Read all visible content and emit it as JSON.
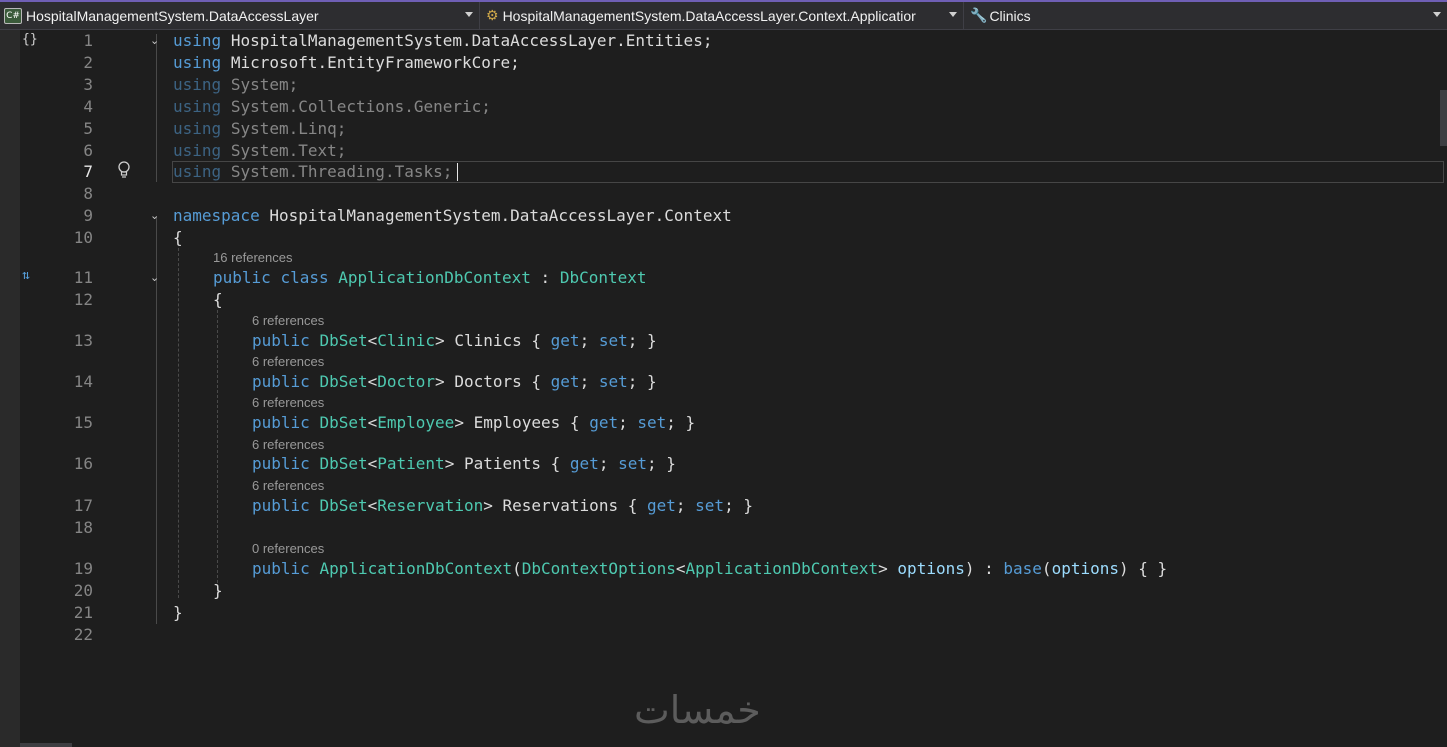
{
  "navbar": {
    "project": "HospitalManagementSystem.DataAccessLayer",
    "type_scope": "HospitalManagementSystem.DataAccessLayer.Context.Applicatior",
    "member": "Clinics"
  },
  "refs": {
    "class": "16 references",
    "clinics": "6 references",
    "doctors": "6 references",
    "employees": "6 references",
    "patients": "6 references",
    "reservations": "6 references",
    "ctor": "0 references"
  },
  "code": {
    "kw_using": "using",
    "kw_namespace": "namespace",
    "kw_public": "public",
    "kw_class": "class",
    "kw_get": "get",
    "kw_set": "set",
    "kw_base": "base",
    "ns_entities": "HospitalManagementSystem.DataAccessLayer.Entities",
    "ns_efcore": "Microsoft.EntityFrameworkCore",
    "ns_system": "System",
    "ns_collections": "System.Collections.Generic",
    "ns_linq": "System.Linq",
    "ns_text": "System.Text",
    "ns_tasks": "System.Threading.Tasks",
    "ns_context": "HospitalManagementSystem.DataAccessLayer.Context",
    "class_name": "ApplicationDbContext",
    "base_type": "DbContext",
    "dbset": "DbSet",
    "t_clinic": "Clinic",
    "p_clinics": "Clinics",
    "t_doctor": "Doctor",
    "p_doctors": "Doctors",
    "t_employee": "Employee",
    "p_employees": "Employees",
    "t_patient": "Patient",
    "p_patients": "Patients",
    "t_reservation": "Reservation",
    "p_reservations": "Reservations",
    "options_type": "DbContextOptions",
    "param_options": "options"
  },
  "watermark": "خمسات"
}
